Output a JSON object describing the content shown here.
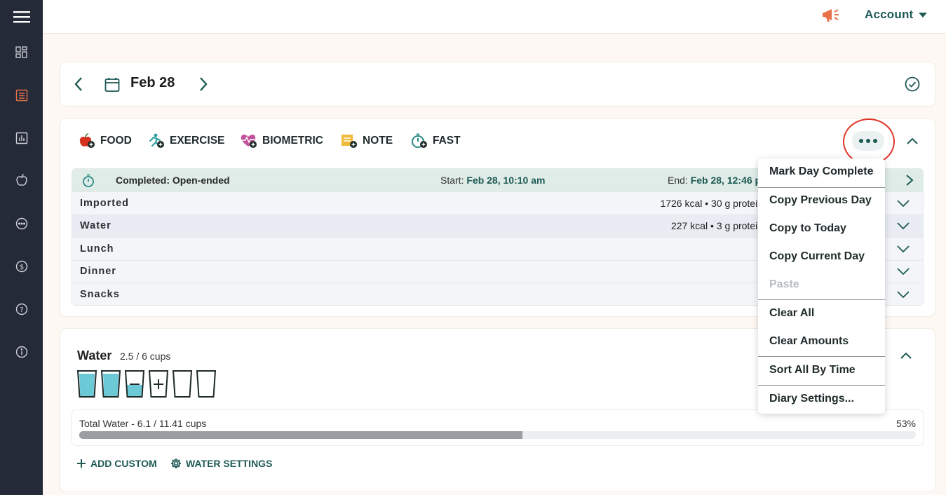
{
  "sidebar": {
    "icons": [
      "menu-icon",
      "dashboard-icon",
      "diary-icon",
      "trends-icon",
      "foods-icon",
      "more-icon",
      "plans-icon",
      "help-icon",
      "info-icon"
    ]
  },
  "topbar": {
    "account_label": "Account",
    "announcement_icon": "megaphone-icon"
  },
  "date_nav": {
    "date": "Feb 28"
  },
  "add_buttons": [
    {
      "label": "FOOD"
    },
    {
      "label": "EXERCISE"
    },
    {
      "label": "BIOMETRIC"
    },
    {
      "label": "NOTE"
    },
    {
      "label": "FAST"
    }
  ],
  "fast": {
    "status": "Completed: Open-ended",
    "start_label": "Start:",
    "start_value": "Feb 28, 10:10 am",
    "end_label": "End:",
    "end_value": "Feb 28, 12:46 pm"
  },
  "meals": [
    {
      "name": "Imported",
      "summary": "1726 kcal • 30 g protein"
    },
    {
      "name": "Water",
      "summary": "227 kcal • 3 g protein"
    },
    {
      "name": "Lunch",
      "summary": ""
    },
    {
      "name": "Dinner",
      "summary": ""
    },
    {
      "name": "Snacks",
      "summary": ""
    }
  ],
  "water": {
    "title": "Water",
    "count": "2.5 / 6 cups",
    "cups_filled": 2.5,
    "cups_total": 6,
    "total_label": "Total Water - 6.1 / 11.41 cups",
    "total_percent_label": "53%",
    "total_percent": 0.53,
    "add_custom": "ADD CUSTOM",
    "water_settings": "WATER SETTINGS"
  },
  "menu": {
    "items": [
      {
        "label": "Mark Day Complete"
      },
      {
        "label": "Copy Previous Day"
      },
      {
        "label": "Copy to Today"
      },
      {
        "label": "Copy Current Day"
      },
      {
        "label": "Paste",
        "disabled": true
      },
      {
        "label": "Clear All"
      },
      {
        "label": "Clear Amounts"
      },
      {
        "label": "Sort All By Time"
      },
      {
        "label": "Diary Settings..."
      }
    ]
  },
  "colors": {
    "accent": "#1e5a55",
    "sidebar": "#252a38",
    "highlight": "#e0362b",
    "diary_active": "#e8734a"
  }
}
